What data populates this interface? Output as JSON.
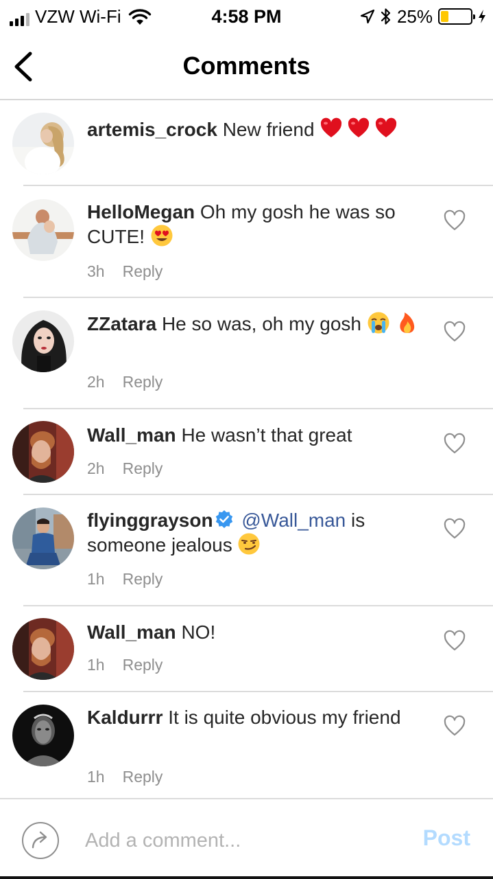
{
  "status_bar": {
    "carrier": "VZW Wi-Fi",
    "time": "4:58 PM",
    "battery_percent": "25%",
    "battery_level": 0.25,
    "icons": [
      "signal-icon",
      "wifi-icon",
      "location-icon",
      "bluetooth-icon",
      "battery-icon",
      "charging-icon"
    ]
  },
  "nav": {
    "title": "Comments",
    "back_icon": "chevron-left-icon"
  },
  "caption": {
    "username": "artemis_crock",
    "text": "New friend",
    "emoji": [
      "red-heart",
      "red-heart",
      "red-heart"
    ]
  },
  "comments": [
    {
      "username": "HelloMegan",
      "text": "Oh my gosh he was so CUTE!",
      "emoji_after": "heart-eyes",
      "time": "3h",
      "reply": "Reply"
    },
    {
      "username": "ZZatara",
      "text": "He so was, oh my gosh",
      "emoji_after": "crying-face fire",
      "time": "2h",
      "reply": "Reply"
    },
    {
      "username": "Wall_man",
      "text": "He wasn’t that great",
      "time": "2h",
      "reply": "Reply"
    },
    {
      "username": "flyinggrayson",
      "verified": true,
      "mention": "@Wall_man",
      "text": "is someone jealous",
      "emoji_after": "smirking-face",
      "time": "1h",
      "reply": "Reply"
    },
    {
      "username": "Wall_man",
      "text": "NO!",
      "time": "1h",
      "reply": "Reply"
    },
    {
      "username": "Kaldurrr",
      "text": "It is quite obvious my friend",
      "time": "1h",
      "reply": "Reply"
    }
  ],
  "composer": {
    "placeholder": "Add a comment...",
    "post_label": "Post",
    "share_icon": "share-arrow-icon"
  },
  "colors": {
    "text": "#262626",
    "secondary": "#8e8e8e",
    "mention": "#385898",
    "post_disabled": "#b3dbff",
    "verified_badge": "#3897f0",
    "divider": "#dbdbdb",
    "battery": "#ffc700"
  }
}
